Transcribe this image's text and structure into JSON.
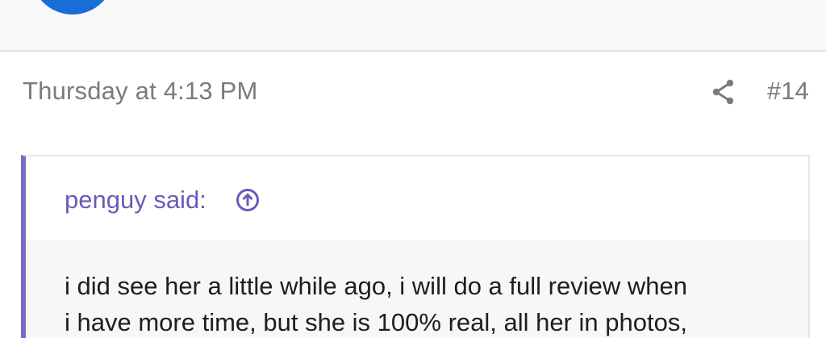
{
  "header": {
    "avatar_icon": "user-avatar",
    "avatar_color": "#1a6fd6"
  },
  "post": {
    "date": "Thursday at 4:13 PM",
    "share_icon": "share-icon",
    "number": "#14"
  },
  "quote": {
    "author_label": "penguy said:",
    "jump_icon": "arrow-up-circle-icon",
    "accent_color": "#7a6bc7",
    "lines": [
      "i did see her a little while ago, i will do a full review when",
      "i have more time, but she is 100% real, all her in photos,"
    ]
  }
}
